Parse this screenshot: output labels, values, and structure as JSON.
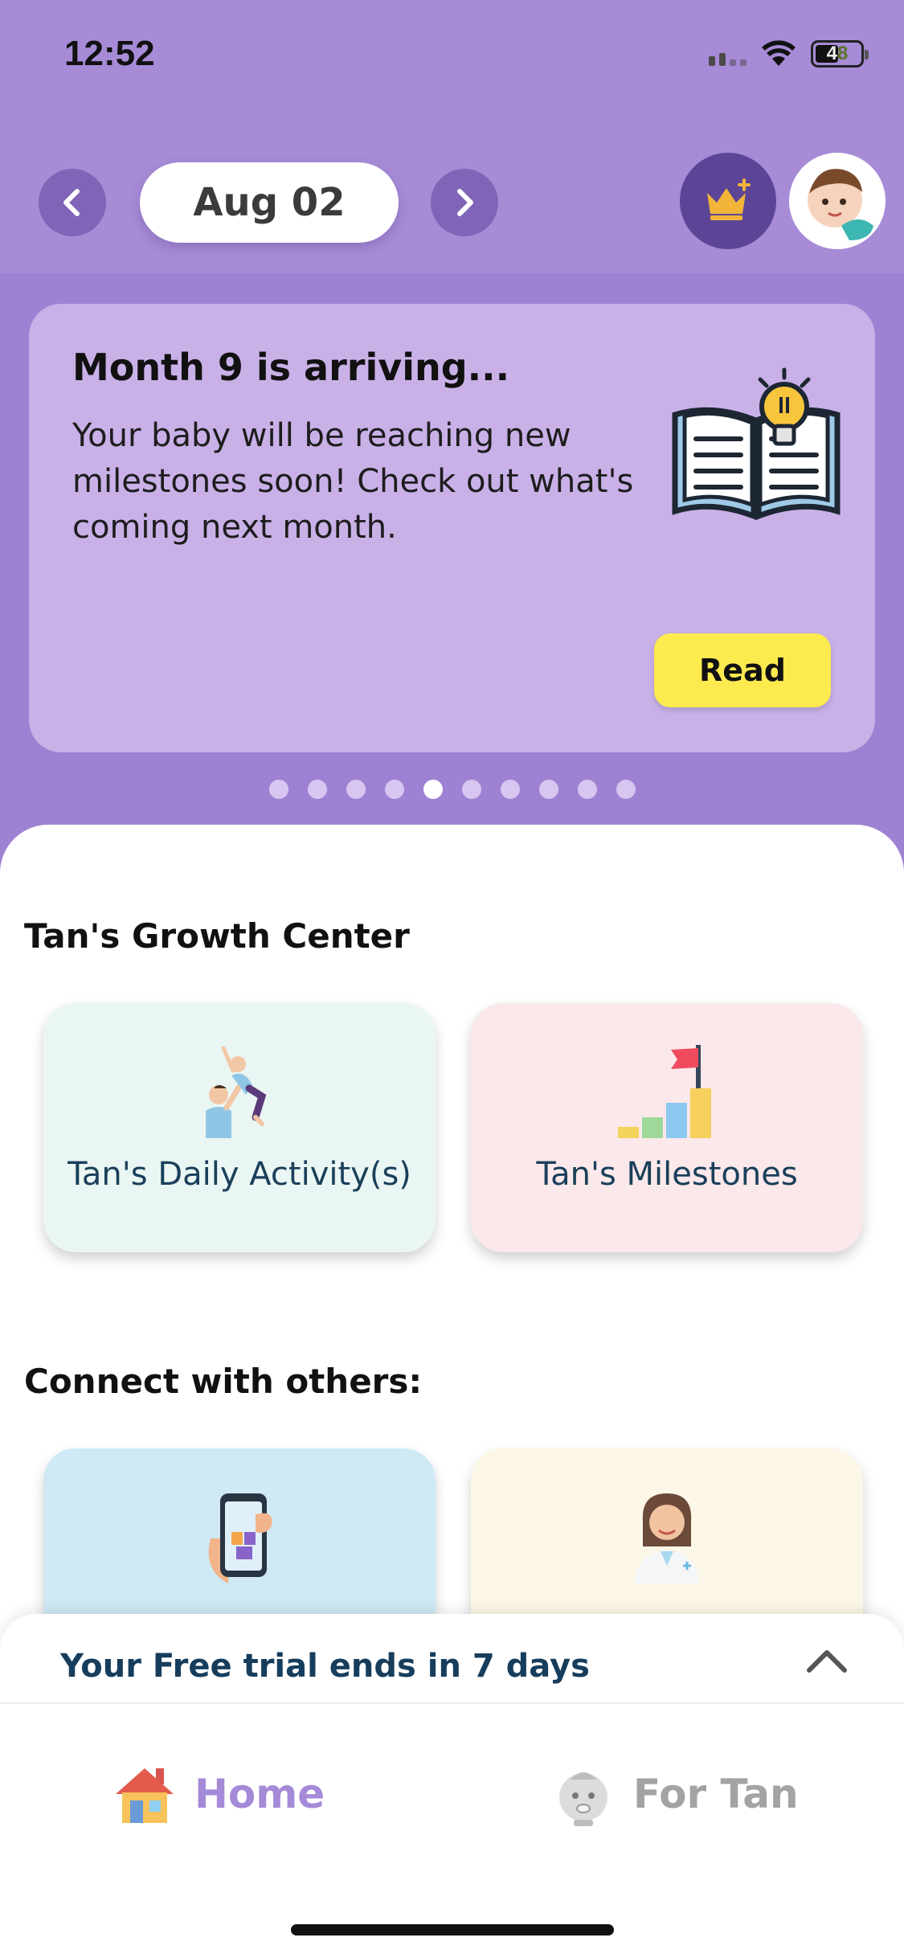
{
  "status_bar": {
    "time": "12:52",
    "battery": "48"
  },
  "nav": {
    "date": "Aug 02"
  },
  "banner": {
    "title": "Month 9 is arriving...",
    "text": "Your baby will be reaching new milestones soon! Check out what's coming next month.",
    "button": "Read",
    "page_count": 10,
    "active_page": 5
  },
  "growth_center": {
    "title": "Tan's Growth Center",
    "tiles": [
      {
        "label": "Tan's Daily Activity(s)",
        "icon": "parent-lifting-baby-icon",
        "bg": "#eaf6f3"
      },
      {
        "label": "Tan's Milestones",
        "icon": "milestone-flag-chart-icon",
        "bg": "#fbe8ea"
      }
    ]
  },
  "connect": {
    "title": "Connect with others:",
    "tiles": [
      {
        "icon": "phone-gift-icon",
        "bg": "#cfe9f5"
      },
      {
        "icon": "doctor-icon",
        "bg": "#fcf7e6"
      }
    ]
  },
  "trial": {
    "text": "Your Free trial ends in 7 days"
  },
  "tabs": [
    {
      "label": "Home",
      "icon": "house-icon",
      "active": true
    },
    {
      "label": "For Tan",
      "icon": "baby-face-icon",
      "active": false
    }
  ],
  "colors": {
    "header_purple": "#a78bd7",
    "banner_card": "#c9b1e8",
    "read_button": "#fcea4f",
    "active_tab": "#a58ad8",
    "trial_text": "#163d5c"
  }
}
